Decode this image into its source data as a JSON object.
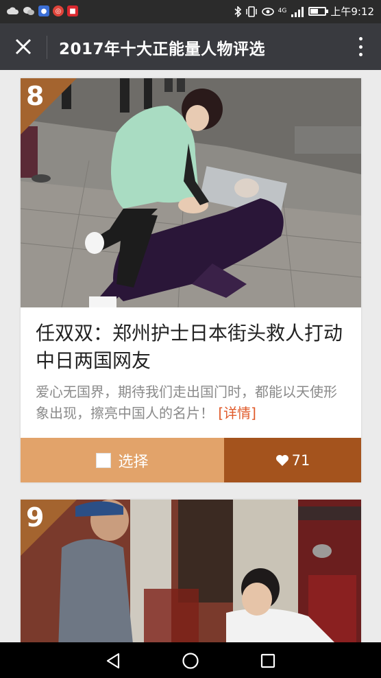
{
  "status_bar": {
    "time": "上午9:12",
    "network": "4G",
    "battery_level": 0.55
  },
  "header": {
    "title": "2017年十大正能量人物评选",
    "close_icon": "close-icon",
    "more_icon": "more-vertical-icon"
  },
  "cards": [
    {
      "rank": "8",
      "title": "任双双：郑州护士日本街头救人打动中日两国网友",
      "description": "爱心无国界，期待我们走出国门时，都能以天使形象出现，擦亮中国人的名片！",
      "details_label": "[详情]",
      "select_label": "选择",
      "votes": "71"
    },
    {
      "rank": "9"
    }
  ],
  "colors": {
    "appbar": "#393a3f",
    "select_button": "#e2a36a",
    "vote_button": "#a4531d",
    "rank_badge": "#a4642f",
    "details_link": "#e05a2a"
  }
}
